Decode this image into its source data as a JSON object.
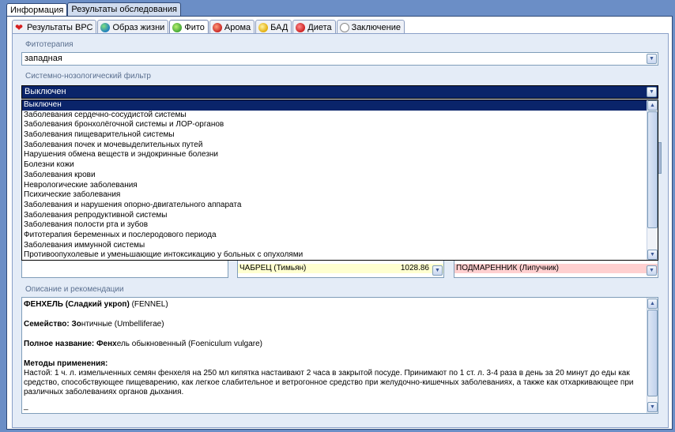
{
  "top_tabs": [
    {
      "label": "Информация",
      "active": true
    },
    {
      "label": "Результаты обследования",
      "active": false
    }
  ],
  "inner_tabs": [
    {
      "label": "Результаты ВРС",
      "icon": "heart-icon"
    },
    {
      "label": "Образ жизни",
      "icon": "globe-icon"
    },
    {
      "label": "Фито",
      "icon": "leaf-icon",
      "active": true
    },
    {
      "label": "Арома",
      "icon": "flower-icon"
    },
    {
      "label": "БАД",
      "icon": "pill-icon"
    },
    {
      "label": "Диета",
      "icon": "strawberry-icon"
    },
    {
      "label": "Заключение",
      "icon": "document-icon"
    }
  ],
  "phyto": {
    "label": "Фитотерапия",
    "value": "западная"
  },
  "filter": {
    "label": "Системно-нозологический фильтр",
    "value": "Выключен",
    "options": [
      "Выключен",
      "Заболевания сердечно-сосудистой системы",
      "Заболевания бронхолёгочной системы и ЛОР-органов",
      "Заболевания пищеварительной системы",
      "Заболевания почек и мочевыделительных путей",
      "Нарушения обмена веществ и эндокринные болезни",
      "Болезни кожи",
      "Заболевания крови",
      "Неврологические заболевания",
      "Психические заболевания",
      "Заболевания и нарушения опорно-двигательного аппарата",
      "Заболевания репродуктивной системы",
      "Заболевания полости рта и зубов",
      "Фитотерапия беременных и послеродового периода",
      "Заболевания иммунной системы",
      "Противоопухолевые и уменьшающие интоксикацию у больных с опухолями"
    ]
  },
  "herbs": {
    "middle": {
      "name": "ЧАБРЕЦ (Тимьян)",
      "value": "1028.86"
    },
    "right": {
      "name": "ПОДМАРЕННИК (Липучник)"
    }
  },
  "description": {
    "label": "Описание и рекомендации",
    "title_bold": "ФЕНХЕЛЬ (Сладкий укроп)",
    "title_rest": " (FENNEL)",
    "family_label": "Семейство: Зо",
    "family_value": "нтичные (Umbelliferae)",
    "fullname_label": "Полное название: Фенх",
    "fullname_value": "ель обыкновенный (Foeniculum vulgare)",
    "methods_label": "Методы применения:",
    "methods_text": "Настой: 1 ч. л. измельченных семян фенхеля на 250 мл кипятка настаивают 2 часа в закрытой посуде. Принимают по 1 ст. л. 3-4 раза в день за 20 минут до еды как средство, способствующее пищеварению, как легкое слабительное и ветрогонное средство при желудочно-кишечных заболеваниях, а также как отхаркивающее при различных заболеваниях органов дыхания.",
    "cursor": "_"
  },
  "colors": {
    "background": "#6b8ec6",
    "panel": "#e4ecf7",
    "selection": "#0a246a",
    "highlight_yellow": "#ffffd0",
    "highlight_pink": "#ffd0d0"
  }
}
